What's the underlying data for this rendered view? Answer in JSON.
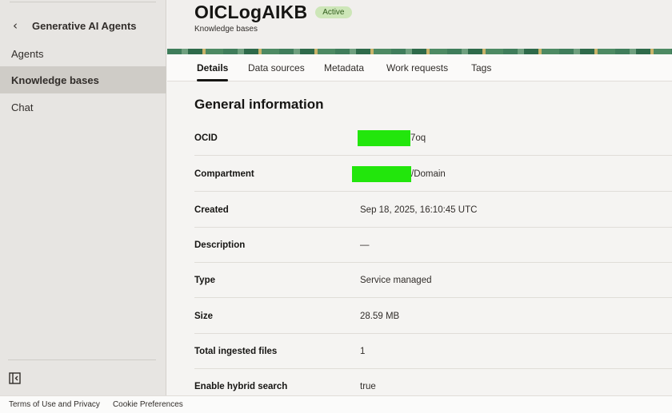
{
  "sidebar": {
    "back_title": "Generative AI Agents",
    "items": [
      {
        "label": "Agents"
      },
      {
        "label": "Knowledge bases"
      },
      {
        "label": "Chat"
      }
    ]
  },
  "header": {
    "name": "OICLogAIKB",
    "status": "Active",
    "subtitle": "Knowledge bases"
  },
  "tabs": [
    "Details",
    "Data sources",
    "Metadata",
    "Work requests",
    "Tags"
  ],
  "general": {
    "title": "General information",
    "rows": [
      {
        "label": "OCID",
        "value": "7oq"
      },
      {
        "label": "Compartment",
        "value": "/Domain"
      },
      {
        "label": "Created",
        "value": "Sep 18, 2025, 16:10:45 UTC"
      },
      {
        "label": "Description",
        "value": "—"
      },
      {
        "label": "Type",
        "value": "Service managed"
      },
      {
        "label": "Size",
        "value": "28.59 MB"
      },
      {
        "label": "Total ingested files",
        "value": "1"
      },
      {
        "label": "Enable hybrid search",
        "value": "true"
      }
    ]
  },
  "footer": {
    "terms": "Terms of Use and Privacy",
    "cookies": "Cookie Preferences"
  },
  "colors": {
    "active_badge_bg": "#cde6b8",
    "redaction": "#22e60c"
  }
}
